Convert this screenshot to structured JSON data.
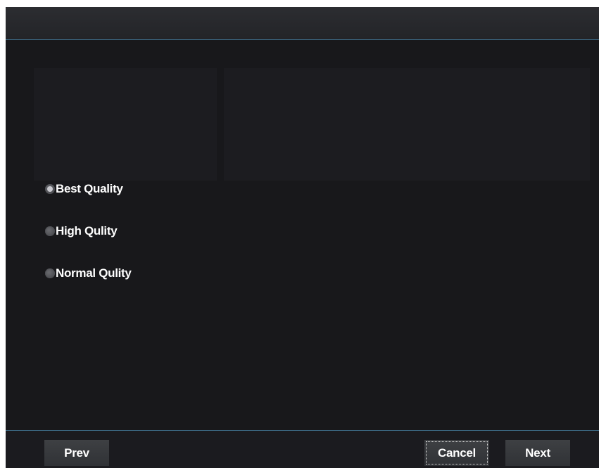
{
  "options": {
    "items": [
      {
        "label": "Best Quality",
        "checked": true
      },
      {
        "label": "High Qulity",
        "checked": false
      },
      {
        "label": "Normal Qulity",
        "checked": false
      }
    ]
  },
  "footer": {
    "prev_label": "Prev",
    "cancel_label": "Cancel",
    "next_label": "Next"
  },
  "colors": {
    "background": "#19191c",
    "divider": "#3f6f8c",
    "button": "#35373a",
    "text": "#ffffff"
  }
}
